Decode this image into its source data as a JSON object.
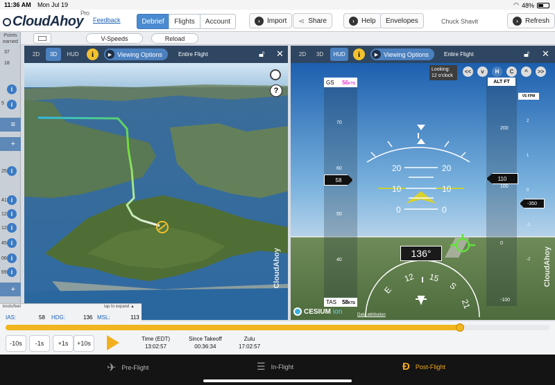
{
  "status": {
    "time": "11:36 AM",
    "date": "Mon Jul 19",
    "battery": "48%"
  },
  "header": {
    "logo": "CloudAhoy",
    "logo_sup": "Pro",
    "feedback": "Feedback",
    "tabs": [
      {
        "label": "Debrief",
        "active": true
      },
      {
        "label": "Flights",
        "active": false
      },
      {
        "label": "Account",
        "active": false
      }
    ],
    "import": "Import",
    "share": "Share",
    "help": "Help",
    "envelopes": "Envelopes",
    "user": "Chuck Shavit",
    "refresh": "Refresh"
  },
  "subheader": {
    "vspeeds": "V-Speeds",
    "reload": "Reload"
  },
  "rail": {
    "points_line1": "Points",
    "points_line2": "earned",
    "values": [
      "37",
      "18",
      "5",
      "25",
      "41",
      "12",
      "12",
      "45",
      "06",
      "69"
    ]
  },
  "pane3d": {
    "tabs": [
      "2D",
      "3D",
      "HUD"
    ],
    "active_tab": "3D",
    "info": "i",
    "viewing_options": "Viewing Options",
    "scope": "Entire Flight",
    "help": "?",
    "watermark": "CloudAhoy"
  },
  "panehud": {
    "tabs": [
      "2D",
      "3D",
      "HUD"
    ],
    "active_tab": "HUD",
    "info": "i",
    "viewing_options": "Viewing Options",
    "scope": "Entire Flight",
    "looking_line1": "Looking:",
    "looking_line2": "12 o'clock",
    "nav_icons": [
      "<<",
      "v",
      "H",
      "C",
      "^",
      ">>"
    ],
    "gs_label": "GS",
    "gs_value": "56",
    "gs_unit": "KTS",
    "tas_label": "TAS",
    "tas_value": "58",
    "tas_unit": "KTS",
    "alt_label": "ALT FT",
    "vs_label": "VS FPM",
    "speed_current": "58",
    "alt_current": "110",
    "vs_current": "-350",
    "heading": "136°",
    "speed_ticks": [
      "70",
      "60",
      "50",
      "40"
    ],
    "alt_ticks": [
      "200",
      "100",
      "0",
      "-100"
    ],
    "vs_ticks": [
      "2",
      "1",
      "0",
      "-1",
      "-2"
    ],
    "pitch_labels": [
      "20",
      "10",
      "0"
    ],
    "compass_labels": [
      "E",
      "12",
      "15",
      "S",
      "21"
    ],
    "cesium": "CESIUM",
    "cesium_ion": "ion",
    "data_attribution": "Data attribution",
    "watermark": "CloudAhoy"
  },
  "infobar": {
    "units": "knots/feet",
    "tap": "tap to expand ▲",
    "ias_label": "IAS:",
    "ias": "58",
    "hdg_label": "HDG:",
    "hdg": "136",
    "msl_label": "MSL:",
    "msl": "113"
  },
  "timeline": {
    "progress": 0.836,
    "buttons": [
      "-10s",
      "-1s",
      "+1s",
      "+10s"
    ],
    "time_label": "Time (EDT)",
    "time_value": "13:02:57",
    "since_label": "Since Takeoff",
    "since_value": "00:36:34",
    "zulu_label": "Zulu",
    "zulu_value": "17:02:57"
  },
  "tabbar": {
    "preflight": "Pre-Flight",
    "inflight": "In-Flight",
    "postflight": "Post-Flight",
    "active": "Post-Flight"
  },
  "colors": {
    "accent": "#f0b51f",
    "header_blue": "#4a8ad0",
    "pane_bar": "#2f4662",
    "hud_green": "#6fdc3a",
    "hud_magenta": "#ff4fd8"
  }
}
